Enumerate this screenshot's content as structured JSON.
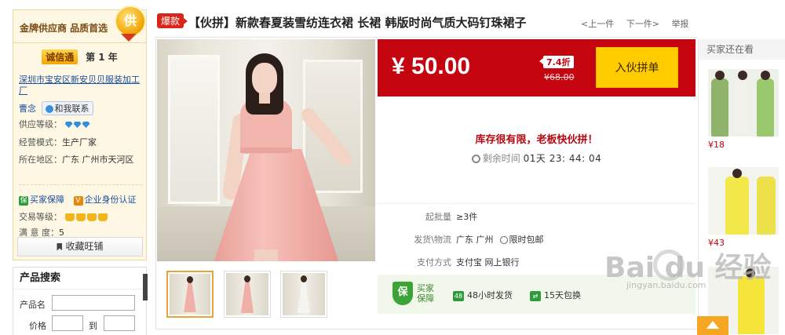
{
  "supplier": {
    "gold_label": "金牌供应商 品质首选",
    "medal_char": "供",
    "chengxin_label": "诚信通",
    "year_label": "第 1 年",
    "company_name": "深圳市宝安区新安贝贝服装加工厂",
    "contact_name": "曹念",
    "chat_label": "和我联系",
    "rows": [
      {
        "key": "供应等级：",
        "value": ""
      },
      {
        "key": "经营模式：",
        "value": "生产厂家"
      },
      {
        "key": "所在地区：",
        "value": "广东 广州市天河区"
      }
    ],
    "buyer_protect": "买家保障",
    "enterprise_auth": "企业身份认证",
    "trade_level_key": "交易等级：",
    "satisfaction_key": "满 意 度：",
    "satisfaction_value": "5",
    "favorite_label": "收藏旺铺"
  },
  "search": {
    "title": "产品搜索",
    "name_label": "产品名",
    "price_label": "价格",
    "to_label": "到"
  },
  "product": {
    "hot_tag": "爆款",
    "title": "【伙拼】新款春夏装雪纺连衣裙 长裙 韩版时尚气质大码钉珠裙子",
    "nav": {
      "prev": "<上一件",
      "next": "下一件>",
      "report": "举报"
    },
    "price": "¥ 50.00",
    "discount": "7.4折",
    "original_price": "¥68.00",
    "join_button": "入伙拼单",
    "stock_message": "库存很有限，老板快伙拼！",
    "countdown_label": "剩余时间",
    "countdown_value": "01天 23: 44: 04",
    "specs": {
      "moq_key": "起批量",
      "moq_value": "≥3件",
      "ship_key": "发货\\物流",
      "ship_value": "广东 广州",
      "ship_extra": "限时包邮",
      "pay_key": "支付方式",
      "pay_value": "支付宝   网上银行"
    },
    "guarantee": {
      "icon": "保",
      "title": "买家保障",
      "item1_badge": "48",
      "item1": "48小时发货",
      "item2": "15天包换"
    }
  },
  "also_view": {
    "title": "买家还在看",
    "items": [
      {
        "price": "¥18"
      },
      {
        "price": "¥43"
      }
    ]
  },
  "watermark": {
    "text": "Bai  du 经验",
    "url": "jingyan.baidu.com"
  },
  "colors": {
    "price_bar": "#c4040f",
    "join_button": "#ffcc00",
    "link_blue": "#1a4fa0",
    "hot_red": "#d8261b"
  }
}
